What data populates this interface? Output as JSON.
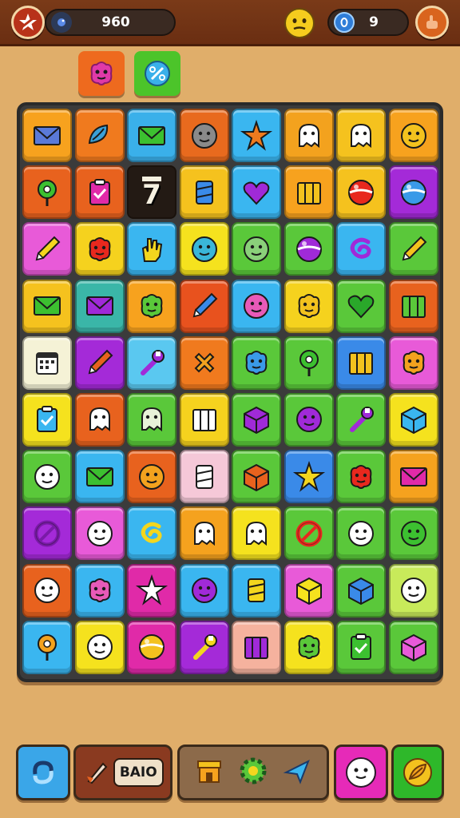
{
  "header": {
    "score": "960",
    "coins": "9",
    "icons": {
      "left_button": "star-badge-icon",
      "score_icon": "bird-icon",
      "mood": "smiley-face-icon",
      "coin_icon": "coin-icon",
      "right_button": "settings-hand-icon"
    }
  },
  "objectives": [
    {
      "icon": "pink-monster-icon",
      "color": "#ee6a1e"
    },
    {
      "icon": "blue-ball-icon",
      "color": "#4cc42a"
    }
  ],
  "board": {
    "rows": [
      [
        {
          "bg": "#f7a21e",
          "icon": "envelope",
          "c": "#5a7ad8"
        },
        {
          "bg": "#f07a1e",
          "icon": "leaf",
          "c": "#3aa0d8"
        },
        {
          "bg": "#3ab0ea",
          "icon": "envelope",
          "c": "#3cc030"
        },
        {
          "bg": "#e86a1e",
          "icon": "face",
          "c": "#8a8a8a"
        },
        {
          "bg": "#3ab6f0",
          "icon": "star",
          "c": "#ee7a1e"
        },
        {
          "bg": "#f3a21e",
          "icon": "ghost",
          "c": "#ffffff"
        },
        {
          "bg": "#f5c21e",
          "icon": "ghost",
          "c": "#ffffff"
        },
        {
          "bg": "#f7a21e",
          "icon": "face",
          "c": "#f3c21e"
        }
      ],
      [
        {
          "bg": "#e8621e",
          "icon": "pin",
          "c": "#3cc030"
        },
        {
          "bg": "#e8621e",
          "icon": "clipboard",
          "c": "#e02aa8"
        },
        {
          "bg": "empty",
          "label": "7",
          "icon": "text"
        },
        {
          "bg": "#f5c21e",
          "icon": "can",
          "c": "#3a8ae8"
        },
        {
          "bg": "#3ab6f0",
          "icon": "heart",
          "c": "#a02ad8"
        },
        {
          "bg": "#f7a21e",
          "icon": "crate",
          "c": "#f3c21e"
        },
        {
          "bg": "#f5c21e",
          "icon": "ball",
          "c": "#e8281e"
        },
        {
          "bg": "#a42ad8",
          "icon": "ball",
          "c": "#3a9ae8"
        }
      ],
      [
        {
          "bg": "#e85ad8",
          "icon": "pencil",
          "c": "#f3d61e"
        },
        {
          "bg": "#f5d21e",
          "icon": "blob",
          "c": "#e8281e"
        },
        {
          "bg": "#3ab6f0",
          "icon": "hand",
          "c": "#f3d61e"
        },
        {
          "bg": "#f5e21e",
          "icon": "face",
          "c": "#3ab6d8"
        },
        {
          "bg": "#5ac83a",
          "icon": "face",
          "c": "#8ad07a"
        },
        {
          "bg": "#5ac83a",
          "icon": "ball",
          "c": "#a02ad8"
        },
        {
          "bg": "#3ab6f0",
          "icon": "swirl",
          "c": "#a02ad8"
        },
        {
          "bg": "#5ac83a",
          "icon": "pencil",
          "c": "#f3c21e"
        }
      ],
      [
        {
          "bg": "#f5c21e",
          "icon": "envelope",
          "c": "#3cc030"
        },
        {
          "bg": "#3ab6a8",
          "icon": "envelope",
          "c": "#a02ad8"
        },
        {
          "bg": "#f7a21e",
          "icon": "blob",
          "c": "#5ac83a"
        },
        {
          "bg": "#e8521e",
          "icon": "pencil",
          "c": "#3a8ae8"
        },
        {
          "bg": "#3ab6f0",
          "icon": "face",
          "c": "#e85ab8"
        },
        {
          "bg": "#f5d21e",
          "icon": "blob",
          "c": "#f3c21e"
        },
        {
          "bg": "#5ac83a",
          "icon": "heart",
          "c": "#2aa82a"
        },
        {
          "bg": "#e8621e",
          "icon": "crate",
          "c": "#5ac83a"
        }
      ],
      [
        {
          "bg": "#f5f2d6",
          "icon": "calendar",
          "c": "#2a2a2a"
        },
        {
          "bg": "#a42ad8",
          "icon": "pencil",
          "c": "#e8621e"
        },
        {
          "bg": "#5ac8f0",
          "icon": "wrench",
          "c": "#a02ad8"
        },
        {
          "bg": "#f07a1e",
          "icon": "cross",
          "c": "#f3a21e"
        },
        {
          "bg": "#5ac83a",
          "icon": "blob",
          "c": "#3a9ae8"
        },
        {
          "bg": "#5ac83a",
          "icon": "pin",
          "c": "#3cc030"
        },
        {
          "bg": "#3a8ae8",
          "icon": "crate",
          "c": "#f3c21e"
        },
        {
          "bg": "#e85ad8",
          "icon": "blob",
          "c": "#f3a21e"
        }
      ],
      [
        {
          "bg": "#f5e21e",
          "icon": "clipboard",
          "c": "#3ab6f0"
        },
        {
          "bg": "#e8621e",
          "icon": "ghost",
          "c": "#ffffff"
        },
        {
          "bg": "#5ac83a",
          "icon": "ghost",
          "c": "#e8f2d8"
        },
        {
          "bg": "#f5d21e",
          "icon": "crate",
          "c": "#ffffff"
        },
        {
          "bg": "#5ac83a",
          "icon": "cube",
          "c": "#a02ad8"
        },
        {
          "bg": "#5ac83a",
          "icon": "face",
          "c": "#a02ad8"
        },
        {
          "bg": "#5ac83a",
          "icon": "wrench",
          "c": "#a02ad8"
        },
        {
          "bg": "#f5e21e",
          "icon": "cube",
          "c": "#3ab6f0"
        }
      ],
      [
        {
          "bg": "#5ac83a",
          "icon": "face",
          "c": "#ffffff"
        },
        {
          "bg": "#3ab6f0",
          "icon": "envelope",
          "c": "#3cc030"
        },
        {
          "bg": "#e8621e",
          "icon": "face",
          "c": "#f3a21e"
        },
        {
          "bg": "#f5c8d8",
          "icon": "can",
          "c": "#ffffff"
        },
        {
          "bg": "#5ac83a",
          "icon": "cube",
          "c": "#e8621e"
        },
        {
          "bg": "#3a8ae8",
          "icon": "star",
          "c": "#f3d61e"
        },
        {
          "bg": "#5ac83a",
          "icon": "blob",
          "c": "#e8281e"
        },
        {
          "bg": "#f5a21e",
          "icon": "envelope",
          "c": "#e02aa8"
        }
      ],
      [
        {
          "bg": "#a42ad8",
          "icon": "ring",
          "c": "#7a1aa8"
        },
        {
          "bg": "#e85ad8",
          "icon": "face",
          "c": "#ffffff"
        },
        {
          "bg": "#3ab6f0",
          "icon": "swirl",
          "c": "#f3d61e"
        },
        {
          "bg": "#f5a21e",
          "icon": "ghost",
          "c": "#ffffff"
        },
        {
          "bg": "#f5e21e",
          "icon": "ghost",
          "c": "#ffffff"
        },
        {
          "bg": "#5ac83a",
          "icon": "ring",
          "c": "#e8281e"
        },
        {
          "bg": "#5ac83a",
          "icon": "face",
          "c": "#ffffff"
        },
        {
          "bg": "#5ac83a",
          "icon": "face",
          "c": "#3cc030"
        }
      ],
      [
        {
          "bg": "#e8621e",
          "icon": "face",
          "c": "#ffffff"
        },
        {
          "bg": "#3ab6f0",
          "icon": "blob",
          "c": "#e85ab8"
        },
        {
          "bg": "#e02aa8",
          "icon": "star",
          "c": "#ffffff"
        },
        {
          "bg": "#3ab6f0",
          "icon": "face",
          "c": "#a02ad8"
        },
        {
          "bg": "#3ab6f0",
          "icon": "can",
          "c": "#f3d61e"
        },
        {
          "bg": "#e85ad8",
          "icon": "cube",
          "c": "#f5e21e"
        },
        {
          "bg": "#5ac83a",
          "icon": "cube",
          "c": "#3a8ae8"
        },
        {
          "bg": "#c8ea5a",
          "icon": "face",
          "c": "#ffffff"
        }
      ],
      [
        {
          "bg": "#3ab6f0",
          "icon": "pin",
          "c": "#f3a21e"
        },
        {
          "bg": "#f5e21e",
          "icon": "face",
          "c": "#ffffff"
        },
        {
          "bg": "#e02aa8",
          "icon": "ball",
          "c": "#f3c21e"
        },
        {
          "bg": "#a42ad8",
          "icon": "wrench",
          "c": "#f3d61e"
        },
        {
          "bg": "#f5b29e",
          "icon": "crate",
          "c": "#a02ad8"
        },
        {
          "bg": "#f5e21e",
          "icon": "blob",
          "c": "#5ac83a"
        },
        {
          "bg": "#5ac83a",
          "icon": "clipboard",
          "c": "#3cc030"
        },
        {
          "bg": "#5ac83a",
          "icon": "cube",
          "c": "#e85ad8"
        }
      ]
    ]
  },
  "bottom_bar": {
    "button_label": "BAIO",
    "icons": [
      "refresh-icon",
      "rocket-icon",
      "shop-icon",
      "gear-icon",
      "plane-icon",
      "ghost-face-icon",
      "leaf-badge-icon"
    ]
  }
}
